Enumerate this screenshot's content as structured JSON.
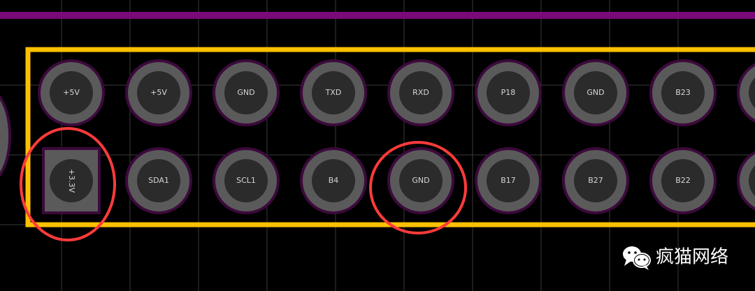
{
  "colors": {
    "background": "#000000",
    "grid": "#3a3a3a",
    "trace": "#7a0a7a",
    "outline": "#ffc000",
    "pad_ring": "#5a5a5a",
    "pad_ring_edge": "#3c0a3c",
    "pad_hole": "#2b2b2b",
    "highlight": "#ff3b3b",
    "label": "#d6d6d6"
  },
  "pads": {
    "top_row": [
      {
        "label": "+5V"
      },
      {
        "label": "+5V"
      },
      {
        "label": "GND"
      },
      {
        "label": "TXD"
      },
      {
        "label": "RXD"
      },
      {
        "label": "P18"
      },
      {
        "label": "GND"
      },
      {
        "label": "B23"
      }
    ],
    "bottom_row": [
      {
        "label": "+3.3V",
        "shape": "square",
        "highlighted": true
      },
      {
        "label": "SDA1"
      },
      {
        "label": "SCL1"
      },
      {
        "label": "B4"
      },
      {
        "label": "GND",
        "highlighted": true
      },
      {
        "label": "B17"
      },
      {
        "label": "B27"
      },
      {
        "label": "B22"
      }
    ]
  },
  "watermark": {
    "text": "疯猫网络",
    "icon": "wechat-icon"
  }
}
